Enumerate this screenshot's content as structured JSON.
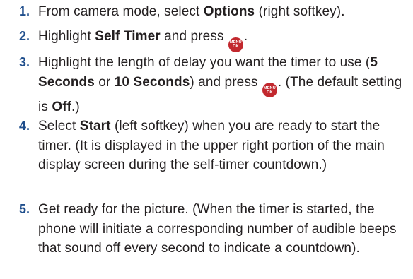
{
  "steps": [
    {
      "number": "1.",
      "parts": [
        "From camera mode, select ",
        "Options",
        " (right softkey)."
      ]
    },
    {
      "number": "2.",
      "parts": [
        "Highlight ",
        "Self Timer",
        " and press ",
        "."
      ]
    },
    {
      "number": "3.",
      "parts": [
        "Highlight the length of delay you want the timer to use (",
        "5 Seconds",
        " or ",
        "10 Seconds",
        ") and press ",
        ". (The default setting is ",
        "Off",
        ".)"
      ]
    },
    {
      "number": "4.",
      "parts": [
        "Select ",
        "Start",
        " (left softkey) when you are ready to start the timer. (It is displayed in the upper right portion of the main display screen during the self-timer countdown.)"
      ]
    },
    {
      "number": "5.",
      "parts": [
        "Get ready for the picture. (When the timer is started, the phone will initiate a corresponding number of audible beeps that sound off every second to indicate a countdown)."
      ]
    }
  ],
  "menu_ok_key": {
    "top_label": "MENU",
    "bottom_label": "OK",
    "color": "#c2282e"
  },
  "colors": {
    "step_number": "#1f4e8c",
    "text": "#231f20"
  }
}
